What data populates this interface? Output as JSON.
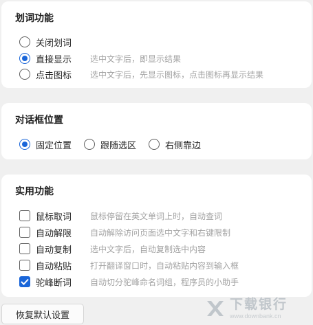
{
  "sections": {
    "word_selection": {
      "title": "划词功能",
      "options": [
        {
          "label": "关闭划词",
          "desc": "",
          "checked": false
        },
        {
          "label": "直接显示",
          "desc": "选中文字后，即显示结果",
          "checked": true
        },
        {
          "label": "点击图标",
          "desc": "选中文字后，先显示图标，点击图标再显示结果",
          "checked": false
        }
      ]
    },
    "dialog_position": {
      "title": "对话框位置",
      "options": [
        {
          "label": "固定位置",
          "checked": true
        },
        {
          "label": "跟随选区",
          "checked": false
        },
        {
          "label": "右侧靠边",
          "checked": false
        }
      ]
    },
    "utilities": {
      "title": "实用功能",
      "items": [
        {
          "label": "鼠标取词",
          "desc": "鼠标停留在英文单词上时，自动查词",
          "checked": false
        },
        {
          "label": "自动解限",
          "desc": "自动解除访问页面选中文字和右键限制",
          "checked": false
        },
        {
          "label": "自动复制",
          "desc": "选中文字后，自动复制选中内容",
          "checked": false
        },
        {
          "label": "自动粘贴",
          "desc": "打开翻译窗口时，自动粘贴内容到输入框",
          "checked": false
        },
        {
          "label": "驼峰断词",
          "desc": "自动切分驼峰命名词组，程序员的小助手",
          "checked": true
        }
      ]
    }
  },
  "reset_button_label": "恢复默认设置",
  "watermark": {
    "main": "下载银行",
    "sub": "www.downbank.cn"
  },
  "colors": {
    "accent": "#1a66d9",
    "background": "#f0f0f0",
    "card": "#ffffff",
    "desc_text": "#a3a3a3"
  }
}
